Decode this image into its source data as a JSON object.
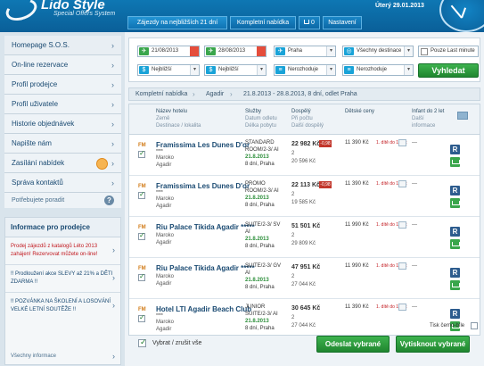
{
  "app": {
    "title": "Lido Style",
    "subtitle": "Special Offers System",
    "date": "Úterý 29.01.2013",
    "tabs": [
      "Zájezdy na nejbližších 21 dní",
      "Kompletní nabídka",
      "0",
      "Nastavení"
    ]
  },
  "sidebar": {
    "items": [
      {
        "label": "Homepage S.O.S."
      },
      {
        "label": "On-line rezervace"
      },
      {
        "label": "Profil prodejce"
      },
      {
        "label": "Profil uživatele"
      },
      {
        "label": "Historie objednávek"
      },
      {
        "label": "Napište nám"
      },
      {
        "label": "Zasílání nabídek"
      },
      {
        "label": "Správa kontaktů"
      }
    ],
    "help": "Potřebujete poradit",
    "info": {
      "title": "Informace pro prodejce",
      "news": [
        "Prodej zájezdů z katalogů Léto 2013 zahájen! Rezervovat můžete on-line!",
        "!! Prodloužení akce SLEVY až 21% a DĚTI ZDARMA !!",
        "!! POZVÁNKA NA ŠKOLENÍ A LOSOVÁNÍ VELKÉ LETNÍ SOUTĚŽE !!"
      ],
      "all_label": "Všechny informace"
    }
  },
  "search": {
    "date_from": "21/08/2013",
    "date_to": "28/08/2013",
    "origin": "Praha",
    "destination": "Všechny destinace",
    "last_minute_label": "Pouze Last minute",
    "from_price": "Nejbližší",
    "to_price": "Nejbližší",
    "sort1": "Nerozhoduje",
    "sort2": "Nerozhoduje",
    "button": "Vyhledat"
  },
  "breadcrumb": [
    "Kompletní nabídka",
    "Agadir",
    "21.8.2013 - 28.8.2013, 8 dní, odlet Praha"
  ],
  "table": {
    "headers": {
      "hotel": "Název hotelu",
      "hotel_sub1": "Země",
      "hotel_sub2": "Destinace / lokalita",
      "svc": "Služby",
      "svc_sub1": "Datum odletu",
      "svc_sub2": "Délka pobytu",
      "adult": "Dospělý",
      "adult_sub1": "Při počtu",
      "adult_sub2": "Další dospělý",
      "child": "Dětské ceny",
      "infant": "Infant do 2 let",
      "infant_sub1": "Další",
      "infant_sub2": "informace"
    },
    "rows": [
      {
        "code": "FM",
        "hotel": "Framissima Les Dunes D'or",
        "stars": "****",
        "country": "Maroko",
        "dest": "Agadir",
        "svc1": "STANDARD",
        "svc2": "ROOM/2-3/ AI",
        "svc3": "21.8.2013",
        "svc4": "8 dní, Praha",
        "price": "22 982 Kč",
        "tag": "-0,98",
        "sub1": "2",
        "sub2": "20 596 Kč",
        "ch_price": "11 390 Kč",
        "ch_info": "1. dítě do 12 let",
        "infant": "—"
      },
      {
        "code": "FM",
        "hotel": "Framissima Les Dunes D'or",
        "stars": "****",
        "country": "Maroko",
        "dest": "Agadir",
        "svc1": "PROMO",
        "svc2": "ROOM/2-3/ AI",
        "svc3": "21.8.2013",
        "svc4": "8 dní, Praha",
        "price": "22 113 Kč",
        "tag": "-0,98",
        "sub1": "2",
        "sub2": "19 585 Kč",
        "ch_price": "11 390 Kč",
        "ch_info": "1. dítě do 12 let",
        "infant": "—"
      },
      {
        "code": "FM",
        "hotel": "Riu Palace Tikida Agadir *****",
        "stars": "",
        "country": "Maroko",
        "dest": "Agadir",
        "svc1": "SUITE/2-3/ SV",
        "svc2": "AI",
        "svc3": "21.8.2013",
        "svc4": "8 dní, Praha",
        "price": "51 501 Kč",
        "tag": "",
        "sub1": "2",
        "sub2": "29 809 Kč",
        "ch_price": "11 990 Kč",
        "ch_info": "1. dítě do 12 let",
        "infant": "—"
      },
      {
        "code": "FM",
        "hotel": "Riu Palace Tikida Agadir *****",
        "stars": "",
        "country": "Maroko",
        "dest": "Agadir",
        "svc1": "SUITE/2-3/ GV",
        "svc2": "AI",
        "svc3": "21.8.2013",
        "svc4": "8 dní, Praha",
        "price": "47 951 Kč",
        "tag": "",
        "sub1": "2",
        "sub2": "27 044 Kč",
        "ch_price": "11 990 Kč",
        "ch_info": "1. dítě do 12 let",
        "infant": "—"
      },
      {
        "code": "FM",
        "hotel": "Hotel LTI Agadir Beach Club",
        "stars": "****",
        "country": "Maroko",
        "dest": "Agadir",
        "svc1": "JUNIOR",
        "svc2": "SUITE/2-3/ AI",
        "svc3": "21.8.2013",
        "svc4": "8 dní, Praha",
        "price": "30 645 Kč",
        "tag": "",
        "sub1": "2",
        "sub2": "27 044 Kč",
        "ch_price": "11 390 Kč",
        "ch_info": "1. dítě do 12 let",
        "infant": "—"
      }
    ]
  },
  "footer": {
    "print_bw": "Tisk černo-bíle",
    "select_all": "Vybrat / zrušit vše",
    "send": "Odeslat vybrané",
    "print": "Vytisknout vybrané"
  }
}
